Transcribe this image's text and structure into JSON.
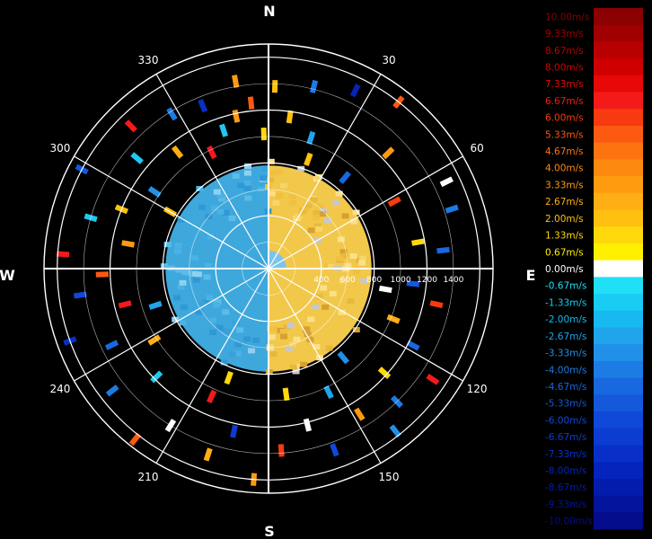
{
  "chart_data": {
    "type": "polar-radar",
    "title": "",
    "compass_labels": {
      "n": "N",
      "e": "E",
      "s": "S",
      "w": "W"
    },
    "bearing_labels": [
      "30",
      "60",
      "120",
      "150",
      "210",
      "240",
      "300",
      "330"
    ],
    "range_labels": [
      "400",
      "600",
      "800",
      "1000",
      "1200",
      "1400"
    ],
    "range_max": 1700,
    "grid": true,
    "colorbar": {
      "position": "right",
      "unit": "m/s",
      "labels": [
        "10.00m/s",
        "9.33m/s",
        "8.67m/s",
        "8.00m/s",
        "7.33m/s",
        "6.67m/s",
        "6.00m/s",
        "5.33m/s",
        "4.67m/s",
        "4.00m/s",
        "3.33m/s",
        "2.67m/s",
        "2.00m/s",
        "1.33m/s",
        "0.67m/s",
        "0.00m/s",
        "-0.67m/s",
        "-1.33m/s",
        "-2.00m/s",
        "-2.67m/s",
        "-3.33m/s",
        "-4.00m/s",
        "-4.67m/s",
        "-5.33m/s",
        "-6.00m/s",
        "-6.67m/s",
        "-7.33m/s",
        "-8.00m/s",
        "-8.67m/s",
        "-9.33m/s",
        "-10.00m/s"
      ],
      "colors": [
        "#8b0000",
        "#a00000",
        "#b80000",
        "#d00000",
        "#e80808",
        "#f41a1a",
        "#f83a10",
        "#fb5a10",
        "#fc7410",
        "#fd8a10",
        "#fe9c10",
        "#ffae14",
        "#ffc010",
        "#ffd80c",
        "#fff000",
        "#ffffff",
        "#20e0f8",
        "#18ccf4",
        "#18b8f0",
        "#20a4ec",
        "#2090e8",
        "#1c7ce4",
        "#1868e0",
        "#1458dc",
        "#1048d8",
        "#0c3cd0",
        "#0830c8",
        "#0424bc",
        "#041cac",
        "#04149c",
        "#040c8c"
      ]
    },
    "echo_core": {
      "outer_range": 780,
      "approach_side": "west",
      "approach_color": "#3ea8dc",
      "receding_side": "east",
      "receding_color": "#f2c84a"
    },
    "scattered_echoes": [
      {
        "az": 350,
        "r": 1440,
        "c": "#ff9a10"
      },
      {
        "az": 338,
        "r": 1330,
        "c": "#0830c8"
      },
      {
        "az": 342,
        "r": 1100,
        "c": "#20c8f0"
      },
      {
        "az": 348,
        "r": 1180,
        "c": "#ff9a10"
      },
      {
        "az": 354,
        "r": 1260,
        "c": "#fb5a10"
      },
      {
        "az": 358,
        "r": 1020,
        "c": "#ffd80c"
      },
      {
        "az": 2,
        "r": 1380,
        "c": "#ffc010"
      },
      {
        "az": 8,
        "r": 1160,
        "c": "#ffc010"
      },
      {
        "az": 14,
        "r": 1420,
        "c": "#1c7ce4"
      },
      {
        "az": 18,
        "r": 1040,
        "c": "#20a4ec"
      },
      {
        "az": 26,
        "r": 1500,
        "c": "#0424bc"
      },
      {
        "az": 38,
        "r": 1600,
        "c": "#fb5a10"
      },
      {
        "az": 46,
        "r": 1260,
        "c": "#ff9a10"
      },
      {
        "az": 62,
        "r": 1080,
        "c": "#f83a10"
      },
      {
        "az": 64,
        "r": 1500,
        "c": "#ffffff"
      },
      {
        "az": 72,
        "r": 1460,
        "c": "#1c7ce4"
      },
      {
        "az": 80,
        "r": 1150,
        "c": "#ffd80c"
      },
      {
        "az": 84,
        "r": 1330,
        "c": "#1868e0"
      },
      {
        "az": 96,
        "r": 1100,
        "c": "#1458dc"
      },
      {
        "az": 102,
        "r": 1300,
        "c": "#f83a10"
      },
      {
        "az": 112,
        "r": 1020,
        "c": "#ffae14"
      },
      {
        "az": 118,
        "r": 1240,
        "c": "#1868e0"
      },
      {
        "az": 124,
        "r": 1500,
        "c": "#f41a1a"
      },
      {
        "az": 132,
        "r": 1180,
        "c": "#ffd80c"
      },
      {
        "az": 136,
        "r": 1400,
        "c": "#1c7ce4"
      },
      {
        "az": 142,
        "r": 1560,
        "c": "#2090e8"
      },
      {
        "az": 148,
        "r": 1300,
        "c": "#ff9a10"
      },
      {
        "az": 154,
        "r": 1040,
        "c": "#20a4ec"
      },
      {
        "az": 160,
        "r": 1460,
        "c": "#1048d8"
      },
      {
        "az": 166,
        "r": 1220,
        "c": "#ffffff"
      },
      {
        "az": 172,
        "r": 960,
        "c": "#ffd80c"
      },
      {
        "az": 176,
        "r": 1380,
        "c": "#f83a10"
      },
      {
        "az": 184,
        "r": 1600,
        "c": "#ff9a10"
      },
      {
        "az": 192,
        "r": 1260,
        "c": "#0c3cd0"
      },
      {
        "az": 198,
        "r": 1480,
        "c": "#ffae14"
      },
      {
        "az": 204,
        "r": 1060,
        "c": "#f41a1a"
      },
      {
        "az": 212,
        "r": 1400,
        "c": "#ffffff"
      },
      {
        "az": 218,
        "r": 1640,
        "c": "#fb5a10"
      },
      {
        "az": 226,
        "r": 1180,
        "c": "#20c8f0"
      },
      {
        "az": 232,
        "r": 1500,
        "c": "#1c7ce4"
      },
      {
        "az": 238,
        "r": 1020,
        "c": "#ffae14"
      },
      {
        "az": 244,
        "r": 1320,
        "c": "#1868e0"
      },
      {
        "az": 250,
        "r": 1600,
        "c": "#0830c8"
      },
      {
        "az": 256,
        "r": 1120,
        "c": "#f41a1a"
      },
      {
        "az": 262,
        "r": 1440,
        "c": "#1048d8"
      },
      {
        "az": 268,
        "r": 1260,
        "c": "#fb5a10"
      },
      {
        "az": 274,
        "r": 1560,
        "c": "#f41a1a"
      },
      {
        "az": 280,
        "r": 1080,
        "c": "#ff9a10"
      },
      {
        "az": 286,
        "r": 1400,
        "c": "#20c8f0"
      },
      {
        "az": 292,
        "r": 1200,
        "c": "#ffc010"
      },
      {
        "az": 298,
        "r": 1600,
        "c": "#1458dc"
      },
      {
        "az": 304,
        "r": 1040,
        "c": "#2090e8"
      },
      {
        "az": 310,
        "r": 1300,
        "c": "#20c8f0"
      },
      {
        "az": 316,
        "r": 1500,
        "c": "#f41a1a"
      },
      {
        "az": 322,
        "r": 1120,
        "c": "#ffae14"
      },
      {
        "az": 328,
        "r": 1380,
        "c": "#1c7ce4"
      },
      {
        "az": 334,
        "r": 980,
        "c": "#f41a1a"
      },
      {
        "az": 20,
        "r": 880,
        "c": "#ffc010"
      },
      {
        "az": 40,
        "r": 900,
        "c": "#1868e0"
      },
      {
        "az": 140,
        "r": 880,
        "c": "#2090e8"
      },
      {
        "az": 200,
        "r": 880,
        "c": "#ffd80c"
      },
      {
        "az": 252,
        "r": 900,
        "c": "#20a4ec"
      },
      {
        "az": 300,
        "r": 860,
        "c": "#ffc010"
      },
      {
        "az": 100,
        "r": 900,
        "c": "#ffffff"
      }
    ]
  }
}
